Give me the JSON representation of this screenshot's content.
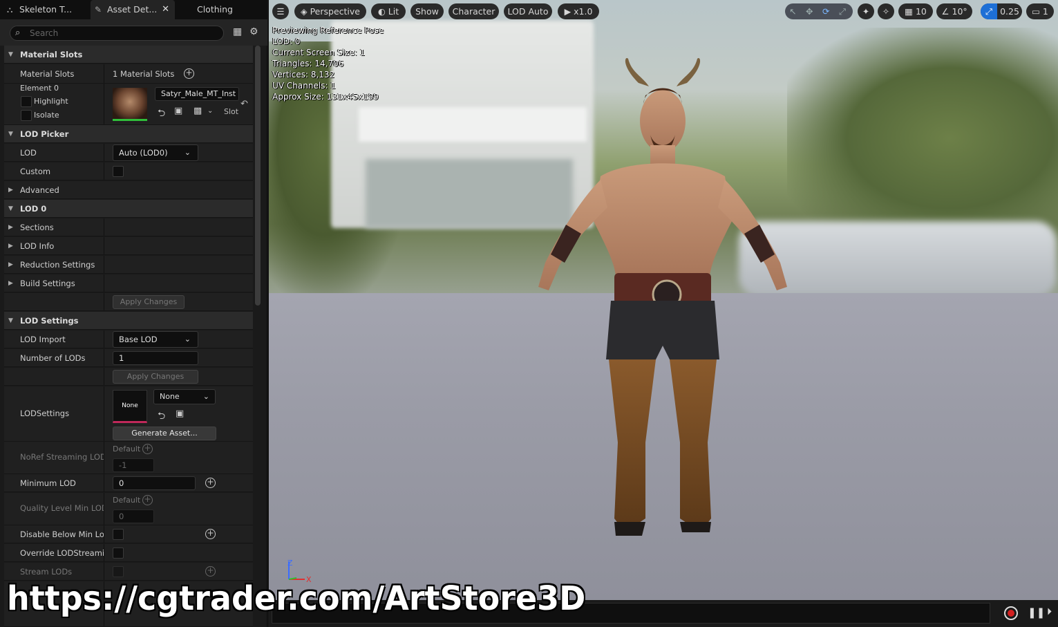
{
  "tabs": [
    {
      "label": "Skeleton T...",
      "icon": "skeleton-icon"
    },
    {
      "label": "Asset Det...",
      "icon": "brush-icon",
      "close": "✕"
    },
    {
      "label": "Clothing"
    }
  ],
  "search": {
    "placeholder": "Search"
  },
  "material_slots": {
    "header": "Material Slots",
    "row_label": "Material Slots",
    "count_text": "1 Material Slots",
    "element_label": "Element 0",
    "highlight": "Highlight",
    "isolate": "Isolate",
    "material_name": "Satyr_Male_MT_Inst",
    "slot_text": "Slot"
  },
  "lod_picker": {
    "header": "LOD Picker",
    "lod_label": "LOD",
    "lod_value": "Auto (LOD0)",
    "custom_label": "Custom",
    "advanced_label": "Advanced"
  },
  "lod0": {
    "header": "LOD 0",
    "sections": "Sections",
    "lod_info": "LOD Info",
    "reduction": "Reduction Settings",
    "build": "Build Settings",
    "apply": "Apply Changes"
  },
  "lod_settings": {
    "header": "LOD Settings",
    "import_label": "LOD Import",
    "import_value": "Base LOD",
    "num_label": "Number of LODs",
    "num_value": "1",
    "apply": "Apply Changes",
    "lodsettings_label": "LODSettings",
    "thumb_text": "None",
    "asset_value": "None",
    "generate": "Generate Asset...",
    "noref_label": "NoRef Streaming LOD B",
    "noref_default": "Default",
    "noref_value": "-1",
    "min_lod_label": "Minimum LOD",
    "min_lod_value": "0",
    "quality_label": "Quality Level Min LOD",
    "quality_default": "Default",
    "quality_value": "0",
    "disable_label": "Disable Below Min Lod...",
    "override_label": "Override LODStreamin...",
    "stream_label": "Stream LODs"
  },
  "viewport": {
    "perspective": "Perspective",
    "lit": "Lit",
    "show": "Show",
    "character": "Character",
    "lod_auto": "LOD Auto",
    "speed": "x1.0",
    "grid_value": "10",
    "angle_value": "10°",
    "scale_value": "0.25",
    "camera_value": "1",
    "stats": [
      "Previewing Reference Pose",
      "LOD: 0",
      "Current Screen Size: 1",
      "Triangles: 14,706",
      "Vertices: 8,132",
      "UV Channels: 1",
      "Approx Size: 131x45x199"
    ],
    "axis_z": "Z",
    "axis_x": "X"
  },
  "watermark": "https://cgtrader.com/ArtStore3D",
  "colors": {
    "accent_blue": "#1d6fd6",
    "record_red": "#d32020",
    "panel": "#1a1a1a"
  }
}
